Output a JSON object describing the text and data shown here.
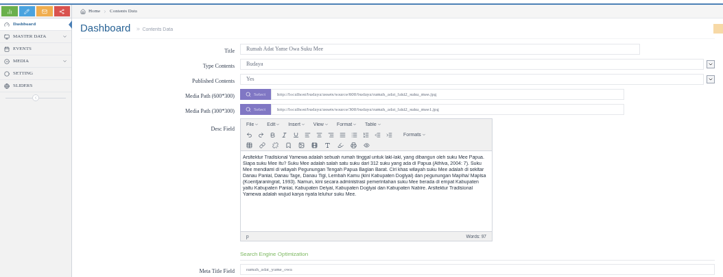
{
  "top_buttons": [
    {
      "color": "#6ab04c"
    },
    {
      "color": "#4aa3df"
    },
    {
      "color": "#f0ad4e"
    },
    {
      "color": "#d9534f"
    }
  ],
  "breadcrumb": [
    "Home",
    "Contents Data"
  ],
  "sidebar": {
    "items": [
      {
        "label": "Dashboard",
        "selected": true,
        "has_caret": false
      },
      {
        "label": "MASTER DATA",
        "selected": false,
        "has_caret": true
      },
      {
        "label": "EVENTS",
        "selected": false,
        "has_caret": false
      },
      {
        "label": "MEDIA",
        "selected": false,
        "has_caret": true
      },
      {
        "label": "SETTING",
        "selected": false,
        "has_caret": false
      },
      {
        "label": "SLIDERS",
        "selected": false,
        "has_caret": false
      }
    ]
  },
  "header": {
    "title": "Dashboard",
    "subtitle": "Contents Data"
  },
  "form": [
    {
      "kind": "text",
      "label": "Title",
      "value": "Rumah Adat Yame Owa Suku Mee"
    },
    {
      "kind": "select",
      "label": "Type Contents",
      "value": "Budaya"
    },
    {
      "kind": "select",
      "label": "Published Contents",
      "value": "Yes"
    },
    {
      "kind": "media",
      "label": "Media Path (600*300)",
      "button": "Select",
      "value": "http://localhost/budaya/assets/source/600/budaya/rumah_adat_laki2_suku_mee.jpg"
    },
    {
      "kind": "media",
      "label": "Media Path (300*300)",
      "button": "Select",
      "value": "http://localhost/budaya/assets/source/300/budaya/rumah_adat_laki2_suku_mee1.jpg"
    }
  ],
  "editor": {
    "label": "Desc Field",
    "menus": [
      "File",
      "Edit",
      "Insert",
      "View",
      "Format",
      "Table"
    ],
    "formats": "Formats",
    "content": "Arsitektur Tradisional Yamewa adalah sebuah rumah tinggal untuk laki-laki, yang dibangun oleh suku Mee Papua. Siapa suku Mee itu? Suku Mee adalah salah satu suku dari 312 suku yang ada di Papua (Athiva, 2004: 7). Suku Mee mendiami di wilayah Pegunungan Tengah Papua Bagian Barat. Ciri khas wilayah suku Mee adalah di sekitar Danau Paniai, Danau Tage, Danau Tigi, Lembah Kamu (kini Kabupaten Dogiyai) dan pegunungan Mapiha/ Mapisa (Koentjaraningrat, 1993). Namun, kini secara administrasi pemerintahan suku Mee berada di empat Kabupaten yaitu Kabupaten Paniai, Kabupaten Deiyai, Kabupaten Dogiyai dan Kabupaten Nabire. Arsitektur Tradisional Yamewa adalah wujud karya nyata leluhur suku Mee.",
    "path": "p",
    "word_count": "Words: 97"
  },
  "seo": {
    "heading": "Search Engine Optimization",
    "fields": [
      {
        "label": "Meta Title Field",
        "value": "rumah_adat_yame_owa"
      }
    ]
  }
}
